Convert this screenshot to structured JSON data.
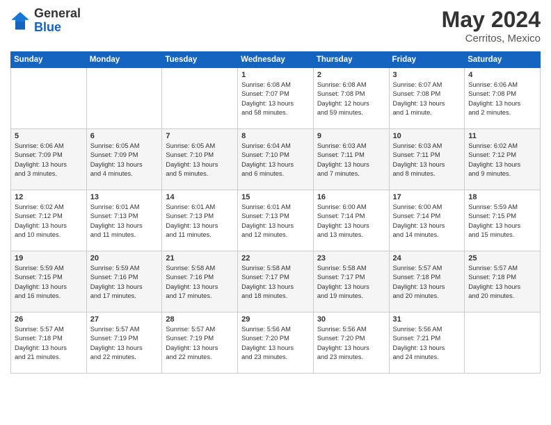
{
  "header": {
    "logo_general": "General",
    "logo_blue": "Blue",
    "month_year": "May 2024",
    "location": "Cerritos, Mexico"
  },
  "days_of_week": [
    "Sunday",
    "Monday",
    "Tuesday",
    "Wednesday",
    "Thursday",
    "Friday",
    "Saturday"
  ],
  "weeks": [
    [
      {
        "day": "",
        "info": ""
      },
      {
        "day": "",
        "info": ""
      },
      {
        "day": "",
        "info": ""
      },
      {
        "day": "1",
        "info": "Sunrise: 6:08 AM\nSunset: 7:07 PM\nDaylight: 13 hours\nand 58 minutes."
      },
      {
        "day": "2",
        "info": "Sunrise: 6:08 AM\nSunset: 7:08 PM\nDaylight: 12 hours\nand 59 minutes."
      },
      {
        "day": "3",
        "info": "Sunrise: 6:07 AM\nSunset: 7:08 PM\nDaylight: 13 hours\nand 1 minute."
      },
      {
        "day": "4",
        "info": "Sunrise: 6:06 AM\nSunset: 7:08 PM\nDaylight: 13 hours\nand 2 minutes."
      }
    ],
    [
      {
        "day": "5",
        "info": "Sunrise: 6:06 AM\nSunset: 7:09 PM\nDaylight: 13 hours\nand 3 minutes."
      },
      {
        "day": "6",
        "info": "Sunrise: 6:05 AM\nSunset: 7:09 PM\nDaylight: 13 hours\nand 4 minutes."
      },
      {
        "day": "7",
        "info": "Sunrise: 6:05 AM\nSunset: 7:10 PM\nDaylight: 13 hours\nand 5 minutes."
      },
      {
        "day": "8",
        "info": "Sunrise: 6:04 AM\nSunset: 7:10 PM\nDaylight: 13 hours\nand 6 minutes."
      },
      {
        "day": "9",
        "info": "Sunrise: 6:03 AM\nSunset: 7:11 PM\nDaylight: 13 hours\nand 7 minutes."
      },
      {
        "day": "10",
        "info": "Sunrise: 6:03 AM\nSunset: 7:11 PM\nDaylight: 13 hours\nand 8 minutes."
      },
      {
        "day": "11",
        "info": "Sunrise: 6:02 AM\nSunset: 7:12 PM\nDaylight: 13 hours\nand 9 minutes."
      }
    ],
    [
      {
        "day": "12",
        "info": "Sunrise: 6:02 AM\nSunset: 7:12 PM\nDaylight: 13 hours\nand 10 minutes."
      },
      {
        "day": "13",
        "info": "Sunrise: 6:01 AM\nSunset: 7:13 PM\nDaylight: 13 hours\nand 11 minutes."
      },
      {
        "day": "14",
        "info": "Sunrise: 6:01 AM\nSunset: 7:13 PM\nDaylight: 13 hours\nand 11 minutes."
      },
      {
        "day": "15",
        "info": "Sunrise: 6:01 AM\nSunset: 7:13 PM\nDaylight: 13 hours\nand 12 minutes."
      },
      {
        "day": "16",
        "info": "Sunrise: 6:00 AM\nSunset: 7:14 PM\nDaylight: 13 hours\nand 13 minutes."
      },
      {
        "day": "17",
        "info": "Sunrise: 6:00 AM\nSunset: 7:14 PM\nDaylight: 13 hours\nand 14 minutes."
      },
      {
        "day": "18",
        "info": "Sunrise: 5:59 AM\nSunset: 7:15 PM\nDaylight: 13 hours\nand 15 minutes."
      }
    ],
    [
      {
        "day": "19",
        "info": "Sunrise: 5:59 AM\nSunset: 7:15 PM\nDaylight: 13 hours\nand 16 minutes."
      },
      {
        "day": "20",
        "info": "Sunrise: 5:59 AM\nSunset: 7:16 PM\nDaylight: 13 hours\nand 17 minutes."
      },
      {
        "day": "21",
        "info": "Sunrise: 5:58 AM\nSunset: 7:16 PM\nDaylight: 13 hours\nand 17 minutes."
      },
      {
        "day": "22",
        "info": "Sunrise: 5:58 AM\nSunset: 7:17 PM\nDaylight: 13 hours\nand 18 minutes."
      },
      {
        "day": "23",
        "info": "Sunrise: 5:58 AM\nSunset: 7:17 PM\nDaylight: 13 hours\nand 19 minutes."
      },
      {
        "day": "24",
        "info": "Sunrise: 5:57 AM\nSunset: 7:18 PM\nDaylight: 13 hours\nand 20 minutes."
      },
      {
        "day": "25",
        "info": "Sunrise: 5:57 AM\nSunset: 7:18 PM\nDaylight: 13 hours\nand 20 minutes."
      }
    ],
    [
      {
        "day": "26",
        "info": "Sunrise: 5:57 AM\nSunset: 7:18 PM\nDaylight: 13 hours\nand 21 minutes."
      },
      {
        "day": "27",
        "info": "Sunrise: 5:57 AM\nSunset: 7:19 PM\nDaylight: 13 hours\nand 22 minutes."
      },
      {
        "day": "28",
        "info": "Sunrise: 5:57 AM\nSunset: 7:19 PM\nDaylight: 13 hours\nand 22 minutes."
      },
      {
        "day": "29",
        "info": "Sunrise: 5:56 AM\nSunset: 7:20 PM\nDaylight: 13 hours\nand 23 minutes."
      },
      {
        "day": "30",
        "info": "Sunrise: 5:56 AM\nSunset: 7:20 PM\nDaylight: 13 hours\nand 23 minutes."
      },
      {
        "day": "31",
        "info": "Sunrise: 5:56 AM\nSunset: 7:21 PM\nDaylight: 13 hours\nand 24 minutes."
      },
      {
        "day": "",
        "info": ""
      }
    ]
  ]
}
